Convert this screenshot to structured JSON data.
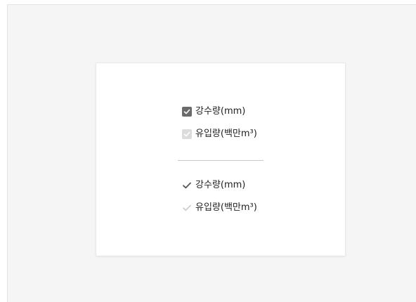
{
  "checkbox_group": {
    "items": [
      {
        "label": "강수량(mm)",
        "state": "checked"
      },
      {
        "label": "유입량(백만m³)",
        "state": "checked-disabled"
      }
    ]
  },
  "check_group": {
    "items": [
      {
        "label": "강수량(mm)",
        "state": "checked"
      },
      {
        "label": "유입량(백만m³)",
        "state": "checked-disabled"
      }
    ]
  },
  "colors": {
    "checked": "#6b6b6b",
    "disabled": "#dcdcdc",
    "check_mark_active": "#555555",
    "check_mark_disabled": "#d0d0d0",
    "background": "#f5f5f5"
  }
}
